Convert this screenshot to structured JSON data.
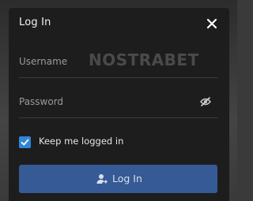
{
  "modal": {
    "title": "Log In"
  },
  "form": {
    "username_placeholder": "Username",
    "password_placeholder": "Password",
    "remember_label": "Keep me logged in",
    "remember_checked": true,
    "submit_label": "Log In"
  },
  "watermark": {
    "text": "NOSTRABET"
  },
  "icons": {
    "close": "close-icon",
    "password_visibility": "eye-off-icon",
    "checkbox": "checkmark-icon",
    "login": "user-login-icon"
  },
  "colors": {
    "modal_bg": "#1d1d1d",
    "checkbox_accent": "#2f86d7",
    "button_bg": "#355a95"
  }
}
